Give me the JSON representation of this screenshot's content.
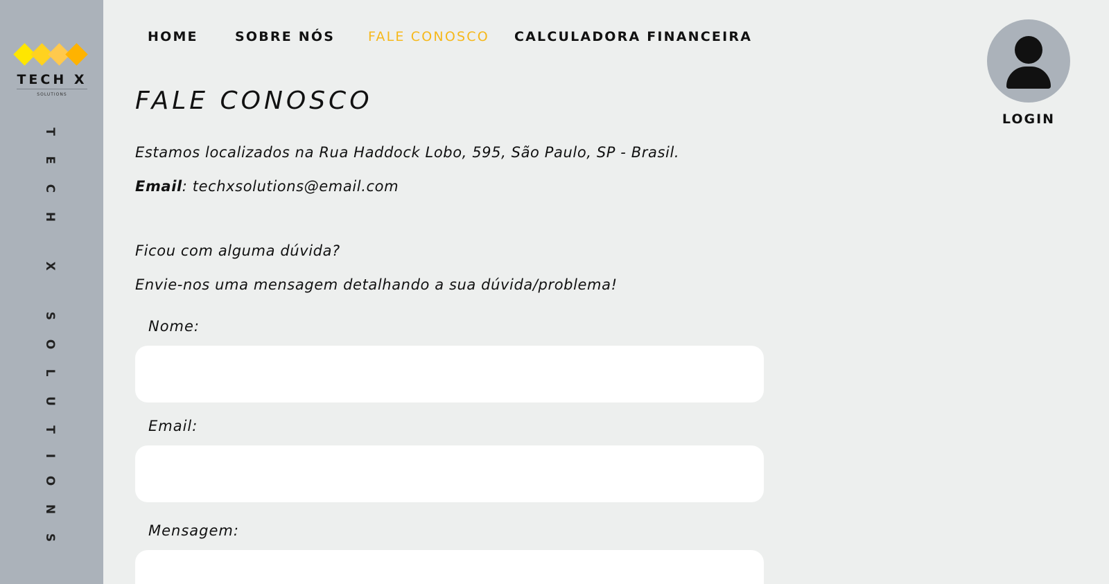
{
  "sidebar": {
    "logo": {
      "title": "TECH X",
      "subtitle": "SOLUTIONS",
      "diamond_colors": [
        "#ffe600",
        "#ffd21f",
        "#ffc94d",
        "#ffb300"
      ]
    },
    "vertical_text": [
      "T",
      "E",
      "C",
      "H",
      "X",
      "S",
      "O",
      "L",
      "U",
      "T",
      "I",
      "O",
      "N",
      "S"
    ],
    "background": "#abb2ba"
  },
  "nav": {
    "items": [
      {
        "label": "HOME"
      },
      {
        "label": "SOBRE NÓS"
      },
      {
        "label": "FALE CONOSCO",
        "active": true
      },
      {
        "label": "CALCULADORA FINANCEIRA"
      }
    ],
    "active_color": "#f6b81a"
  },
  "login": {
    "icon": "user-avatar-icon",
    "label": "LOGIN"
  },
  "main": {
    "title": "FALE CONOSCO",
    "address": "Estamos localizados na Rua Haddock Lobo, 595, São Paulo, SP - Brasil.",
    "email_label": "Email",
    "email_value": ": techxsolutions@email.com",
    "question": "Ficou com alguma dúvida?",
    "prompt": "Envie-nos uma mensagem detalhando a sua dúvida/problema!"
  },
  "form": {
    "name_label": "Nome:",
    "name_value": "",
    "email_label": "Email:",
    "email_value": "",
    "message_label": "Mensagem:",
    "message_value": ""
  }
}
